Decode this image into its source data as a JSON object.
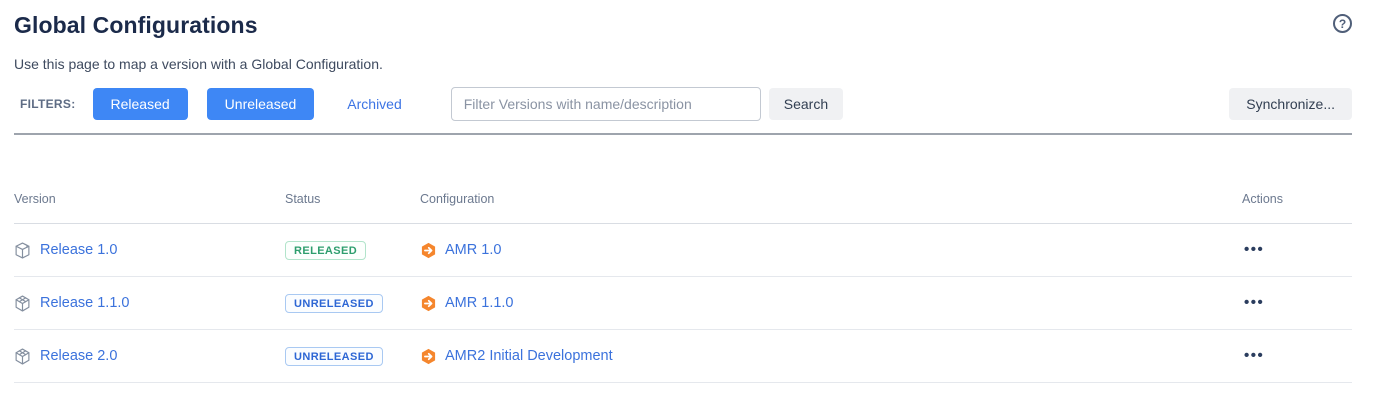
{
  "page": {
    "title": "Global Configurations",
    "subtitle": "Use this page to map a version with a Global Configuration.",
    "help_icon_glyph": "?"
  },
  "filters": {
    "label": "FILTERS:",
    "released_button": "Released",
    "unreleased_button": "Unreleased",
    "archived_link": "Archived",
    "search_placeholder": "Filter Versions with name/description",
    "search_input_value": "",
    "search_button": "Search",
    "synchronize_button": "Synchronize..."
  },
  "table": {
    "columns": [
      "Version",
      "Status",
      "Configuration",
      "Actions"
    ],
    "actions_glyph": "•••",
    "rows": [
      {
        "version": "Release 1.0",
        "version_icon": "released-box",
        "status": "RELEASED",
        "configuration": "AMR 1.0"
      },
      {
        "version": "Release 1.1.0",
        "version_icon": "unreleased-box",
        "status": "UNRELEASED",
        "configuration": "AMR 1.1.0"
      },
      {
        "version": "Release 2.0",
        "version_icon": "unreleased-box",
        "status": "UNRELEASED",
        "configuration": "AMR2 Initial Development"
      }
    ]
  },
  "colors": {
    "primary_blue": "#3e87f5",
    "link_blue": "#3b72dc",
    "title_navy": "#1b2a4a",
    "released_green": "#2e9e6e",
    "unreleased_blue": "#2d66d4",
    "config_orange": "#f5862d",
    "icon_gray": "#848f9f"
  }
}
